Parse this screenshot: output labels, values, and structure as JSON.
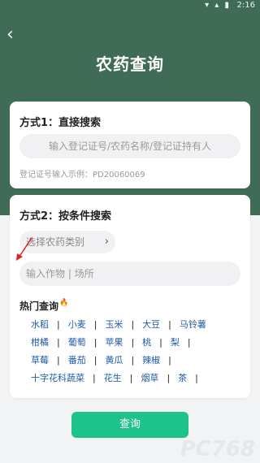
{
  "statusbar": {
    "time": "2:16",
    "icons": "▾ ▴ ▮"
  },
  "header": {
    "back_icon": "‹",
    "title": "农药查询"
  },
  "method1": {
    "title": "方式1：直接搜索",
    "placeholder": "输入登记证号/农药名称/登记证持有人",
    "hint": "登记证号输入示例：PD20060069"
  },
  "method2": {
    "title": "方式2：按条件搜索",
    "category_placeholder": "选择农药类别",
    "chevron": "›",
    "crop_placeholder": "输入作物 | 场所"
  },
  "hot": {
    "title": "热门查询",
    "fire_icon": "🔥",
    "separator": "|",
    "rows": [
      [
        "水稻",
        "小麦",
        "玉米",
        "大豆",
        "马铃薯"
      ],
      [
        "柑橘",
        "葡萄",
        "苹果",
        "桃",
        "梨"
      ],
      [
        "草莓",
        "番茄",
        "黄瓜",
        "辣椒"
      ],
      [
        "十字花科蔬菜",
        "花生",
        "烟草",
        "茶"
      ]
    ]
  },
  "query_button": "查询",
  "watermark": "PC768",
  "colors": {
    "header_bg": "#3f6b57",
    "button_bg": "#1ec28b",
    "link": "#1f5aa6",
    "arrow": "#e02020"
  }
}
